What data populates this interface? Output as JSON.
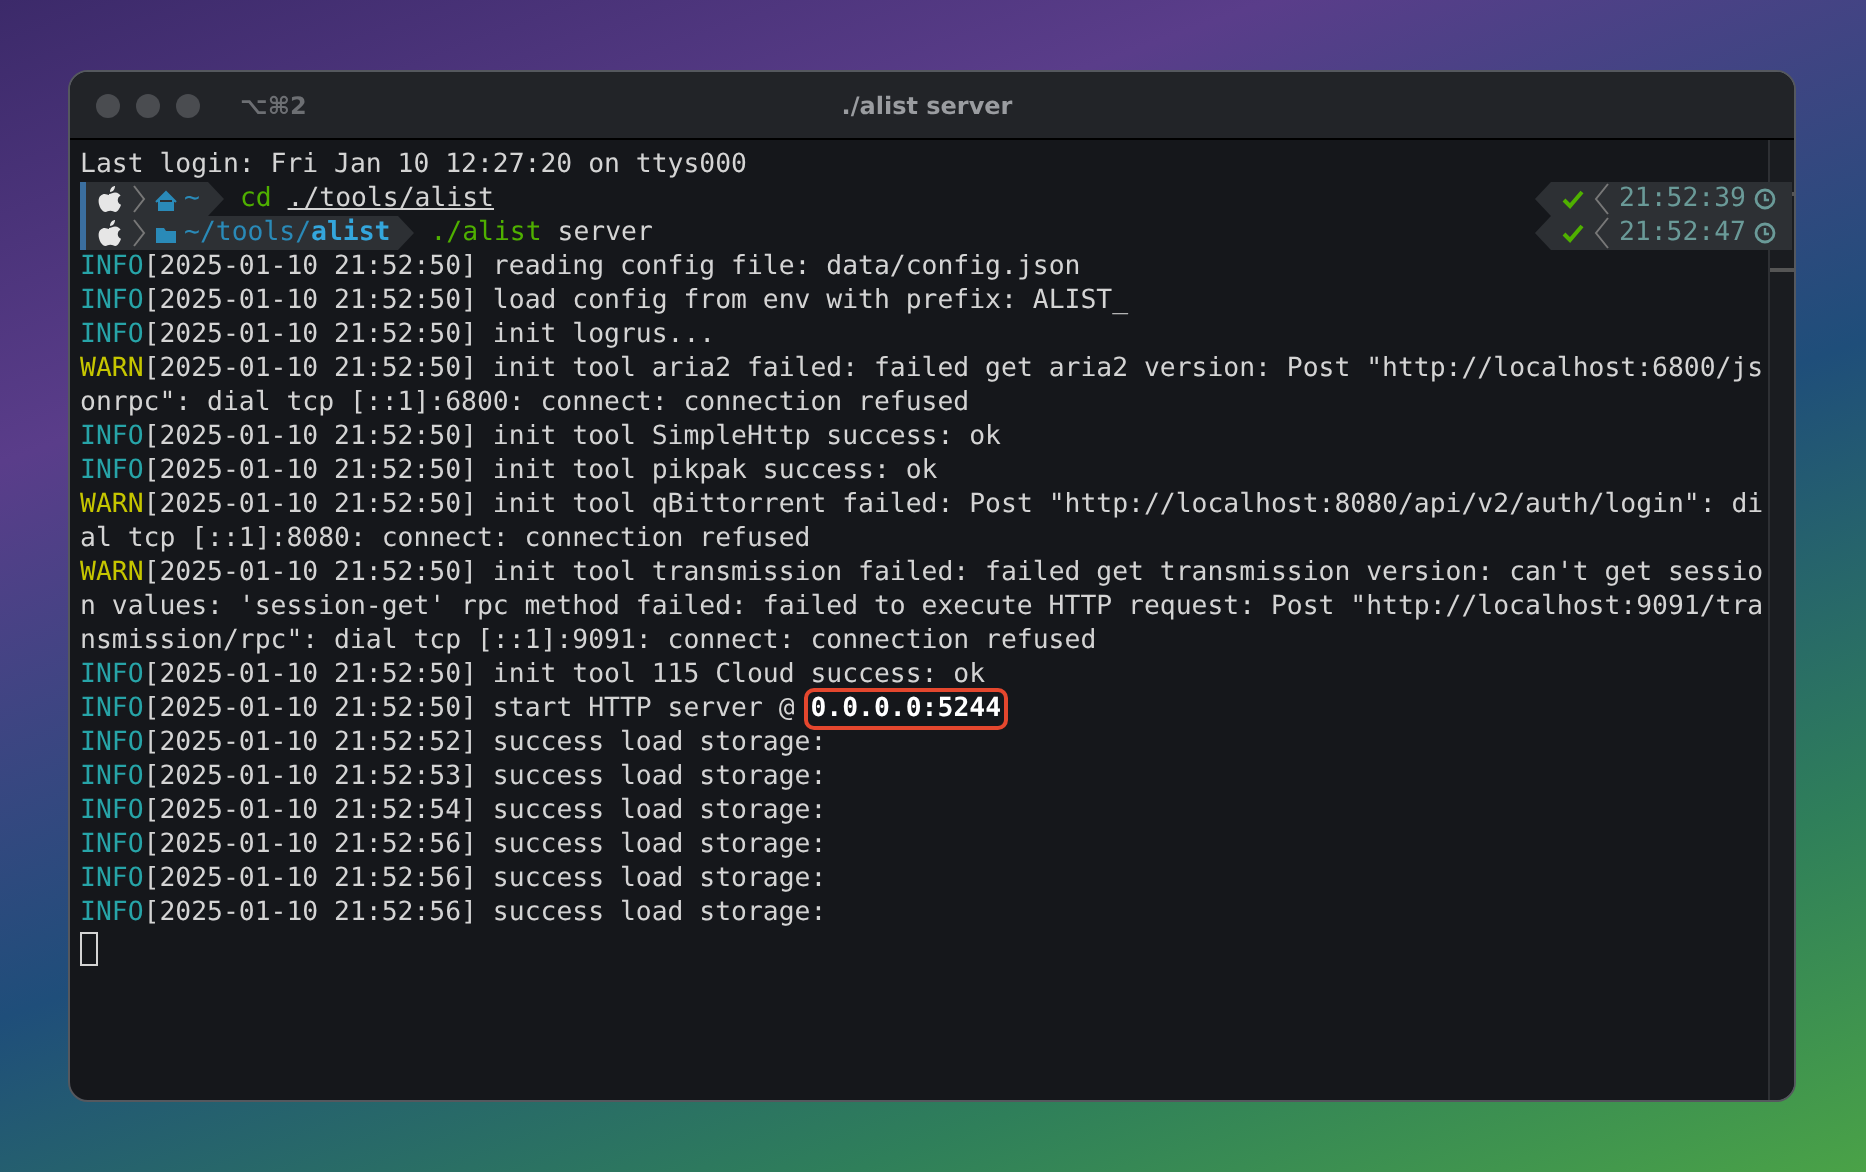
{
  "window": {
    "title": "./alist server",
    "shortcut": "⌥⌘2"
  },
  "last_login": "Last login: Fri Jan 10 12:27:20 on ttys000",
  "prompts": [
    {
      "kind": "home",
      "dir_dim": "~",
      "command": "cd",
      "args": "./tools/alist",
      "args_underlined": true,
      "status_ok": true,
      "time": "21:52:39"
    },
    {
      "kind": "folder",
      "dir_dim": "~/tools/",
      "dir_bold": "alist",
      "command": "./alist",
      "args": "server",
      "args_underlined": false,
      "status_ok": true,
      "time": "21:52:47"
    }
  ],
  "log": [
    {
      "level": "INFO",
      "rest": "[2025-01-10 21:52:50] reading config file: data/config.json"
    },
    {
      "level": "INFO",
      "rest": "[2025-01-10 21:52:50] load config from env with prefix: ALIST_"
    },
    {
      "level": "INFO",
      "rest": "[2025-01-10 21:52:50] init logrus..."
    },
    {
      "level": "WARN",
      "rest": "[2025-01-10 21:52:50] init tool aria2 failed: failed get aria2 version: Post \"http://localhost:6800/jsonrpc\": dial tcp [::1]:6800: connect: connection refused"
    },
    {
      "level": "INFO",
      "rest": "[2025-01-10 21:52:50] init tool SimpleHttp success: ok"
    },
    {
      "level": "INFO",
      "rest": "[2025-01-10 21:52:50] init tool pikpak success: ok"
    },
    {
      "level": "WARN",
      "rest": "[2025-01-10 21:52:50] init tool qBittorrent failed: Post \"http://localhost:8080/api/v2/auth/login\": dial tcp [::1]:8080: connect: connection refused"
    },
    {
      "level": "WARN",
      "rest": "[2025-01-10 21:52:50] init tool transmission failed: failed get transmission version: can't get session values: 'session-get' rpc method failed: failed to execute HTTP request: Post \"http://localhost:9091/transmission/rpc\": dial tcp [::1]:9091: connect: connection refused"
    },
    {
      "level": "INFO",
      "rest": "[2025-01-10 21:52:50] init tool 115 Cloud success: ok"
    },
    {
      "level": "INFO",
      "rest": "[2025-01-10 21:52:50] start HTTP server @ ",
      "highlight": "0.0.0.0:5244"
    },
    {
      "level": "INFO",
      "rest": "[2025-01-10 21:52:52] success load storage:"
    },
    {
      "level": "INFO",
      "rest": "[2025-01-10 21:52:53] success load storage:"
    },
    {
      "level": "INFO",
      "rest": "[2025-01-10 21:52:54] success load storage:"
    },
    {
      "level": "INFO",
      "rest": "[2025-01-10 21:52:56] success load storage:"
    },
    {
      "level": "INFO",
      "rest": "[2025-01-10 21:52:56] success load storage:"
    },
    {
      "level": "INFO",
      "rest": "[2025-01-10 21:52:56] success load storage:"
    }
  ]
}
